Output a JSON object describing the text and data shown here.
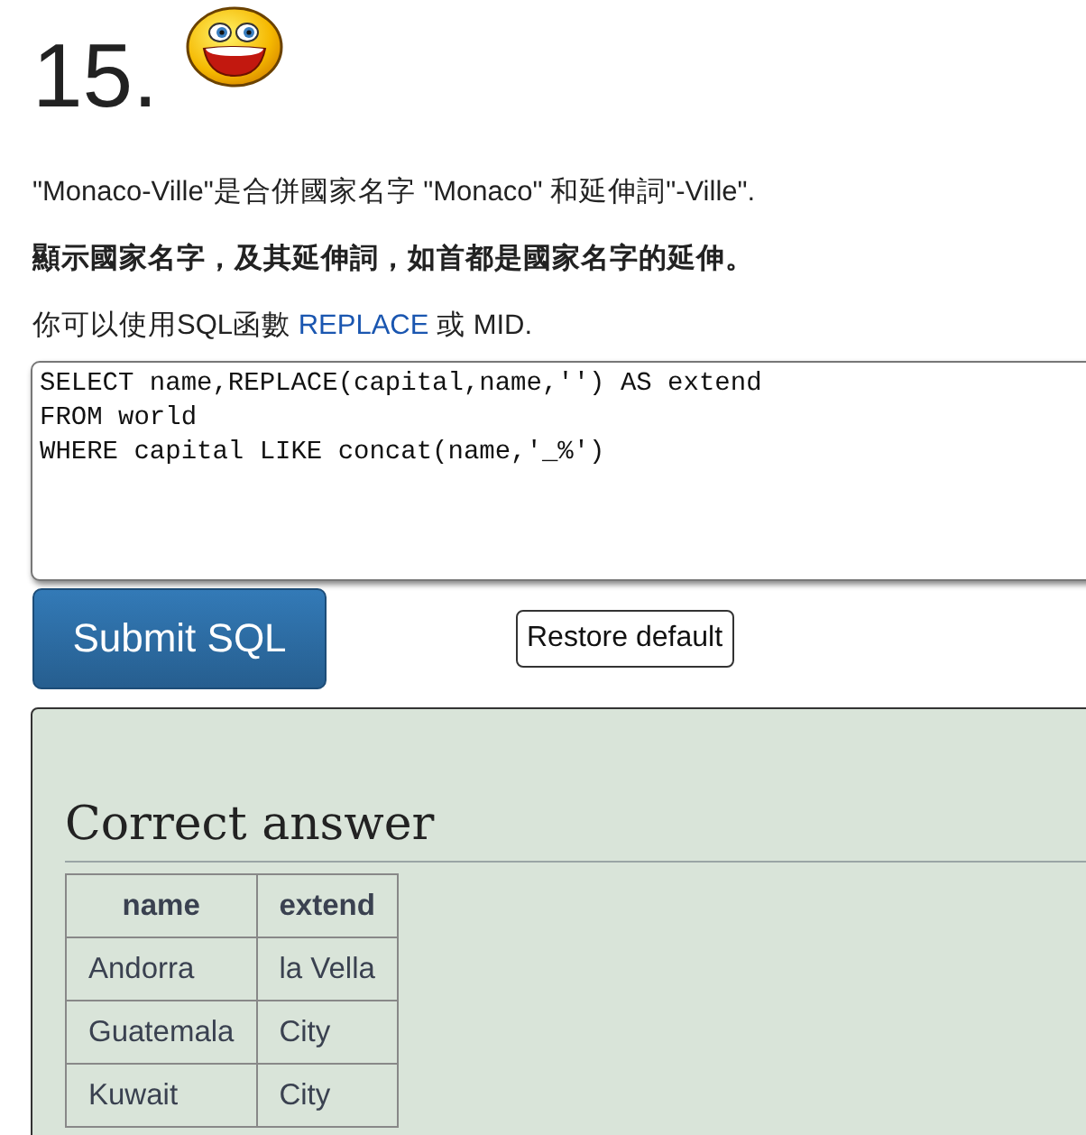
{
  "question": {
    "number": "15."
  },
  "paragraphs": [
    {
      "text": "\"Monaco-Ville\"是合併國家名字 \"Monaco\" 和延伸詞\"-Ville\".",
      "bold": false
    },
    {
      "text": "顯示國家名字，及其延伸詞，如首都是國家名字的延伸。",
      "bold": true
    }
  ],
  "hint": {
    "before": "你可以使用SQL函數 ",
    "link": "REPLACE",
    "after": " 或 MID."
  },
  "editor": {
    "value": "SELECT name,REPLACE(capital,name,'') AS extend\nFROM world\nWHERE capital LIKE concat(name,'_%')"
  },
  "buttons": {
    "submit": "Submit SQL",
    "restore": "Restore default"
  },
  "answer": {
    "title": "Correct answer",
    "columns": [
      "name",
      "extend"
    ],
    "rows": [
      [
        "Andorra",
        "la Vella"
      ],
      [
        "Guatemala",
        "City"
      ],
      [
        "Kuwait",
        "City"
      ]
    ]
  }
}
